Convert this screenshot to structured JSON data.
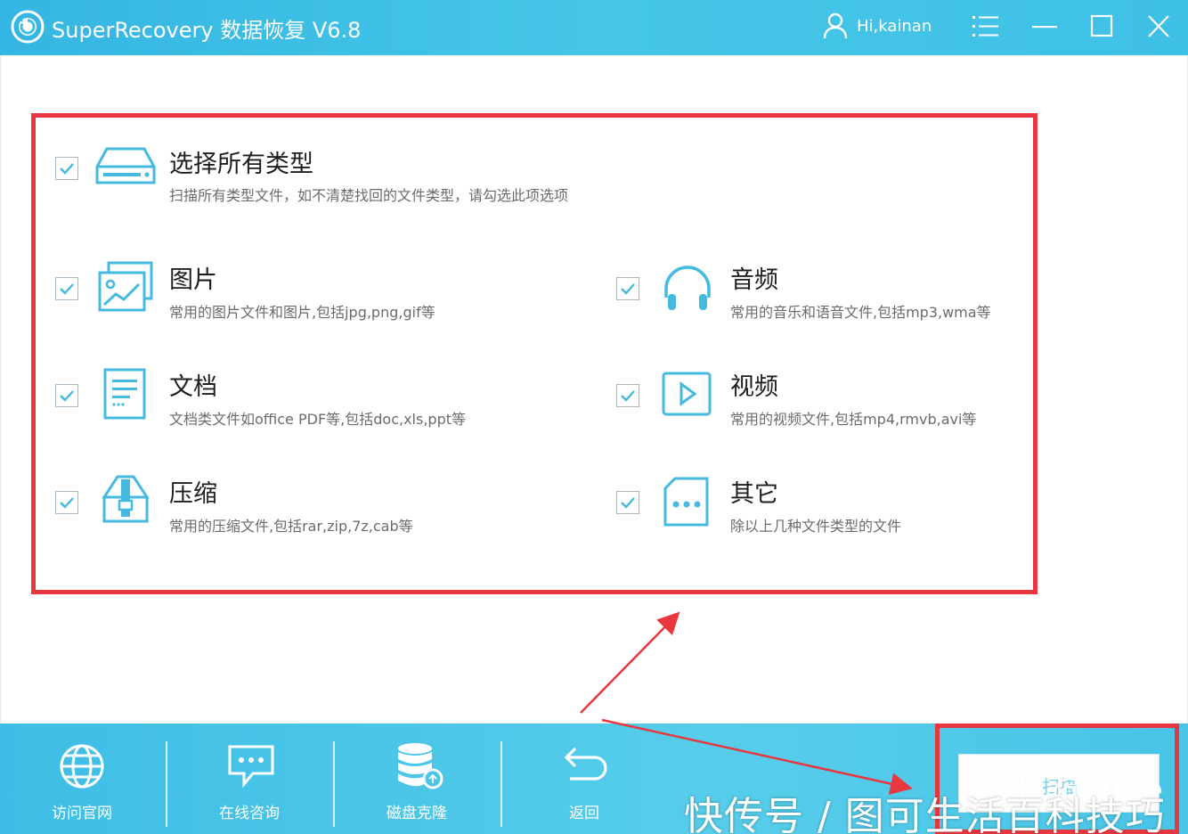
{
  "titlebar": {
    "app_title": "SuperRecovery 数据恢复 V6.8",
    "user": "Hi,kainan"
  },
  "options": {
    "all": {
      "title": "选择所有类型",
      "desc": "扫描所有类型文件，如不清楚找回的文件类型，请勾选此项选项",
      "checked": true,
      "icon": "drive-icon"
    },
    "image": {
      "title": "图片",
      "desc": "常用的图片文件和图片,包括jpg,png,gif等",
      "checked": true,
      "icon": "picture-icon"
    },
    "audio": {
      "title": "音频",
      "desc": "常用的音乐和语音文件,包括mp3,wma等",
      "checked": true,
      "icon": "headphones-icon"
    },
    "document": {
      "title": "文档",
      "desc": "文档类文件如office PDF等,包括doc,xls,ppt等",
      "checked": true,
      "icon": "document-icon"
    },
    "video": {
      "title": "视频",
      "desc": "常用的视频文件,包括mp4,rmvb,avi等",
      "checked": true,
      "icon": "play-icon"
    },
    "archive": {
      "title": "压缩",
      "desc": "常用的压缩文件,包括rar,zip,7z,cab等",
      "checked": true,
      "icon": "archive-icon"
    },
    "other": {
      "title": "其它",
      "desc": "除以上几种文件类型的文件",
      "checked": true,
      "icon": "more-file-icon"
    }
  },
  "bottombar": {
    "website": "访问官网",
    "chat": "在线咨询",
    "clone": "磁盘克隆",
    "back": "返回",
    "scan": "扫描"
  },
  "watermark": {
    "zhihu": "知乎 @tuke",
    "source": "快传号 / 图可生活百科技巧"
  },
  "colors": {
    "accent": "#3fbde6",
    "highlight": "#e8373e",
    "icon": "#45b9e0"
  }
}
